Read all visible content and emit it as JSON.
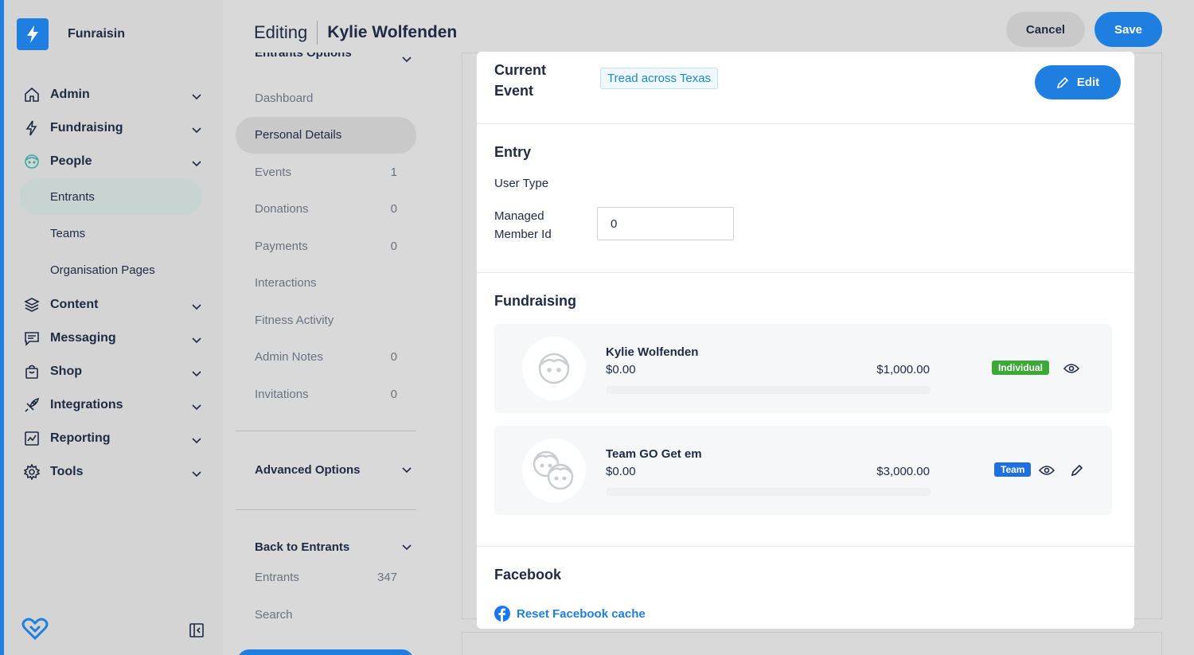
{
  "brand": {
    "name": "Funraisin"
  },
  "sidebar": {
    "items": [
      {
        "label": "Admin",
        "icon": "home-icon"
      },
      {
        "label": "Fundraising",
        "icon": "bolt-icon"
      },
      {
        "label": "People",
        "icon": "face-icon"
      },
      {
        "label": "Content",
        "icon": "layers-icon"
      },
      {
        "label": "Messaging",
        "icon": "message-icon"
      },
      {
        "label": "Shop",
        "icon": "bag-icon"
      },
      {
        "label": "Integrations",
        "icon": "rocket-icon"
      },
      {
        "label": "Reporting",
        "icon": "chart-icon"
      },
      {
        "label": "Tools",
        "icon": "gear-icon"
      }
    ],
    "people_sub": [
      "Entrants",
      "Teams",
      "Organisation Pages"
    ]
  },
  "header": {
    "editing_label": "Editing",
    "entity_name": "Kylie Wolfenden",
    "cancel_label": "Cancel",
    "save_label": "Save"
  },
  "subnav": {
    "entrants_options_label": "Entrants Options",
    "items": [
      {
        "label": "Dashboard",
        "count": ""
      },
      {
        "label": "Personal Details",
        "count": ""
      },
      {
        "label": "Events",
        "count": "1"
      },
      {
        "label": "Donations",
        "count": "0"
      },
      {
        "label": "Payments",
        "count": "0"
      },
      {
        "label": "Interactions",
        "count": ""
      },
      {
        "label": "Fitness Activity",
        "count": ""
      },
      {
        "label": "Admin Notes",
        "count": "0"
      },
      {
        "label": "Invitations",
        "count": "0"
      }
    ],
    "advanced_options_label": "Advanced Options",
    "back_label": "Back to Entrants",
    "back_items": [
      {
        "label": "Entrants",
        "count": "347"
      },
      {
        "label": "Search",
        "count": ""
      }
    ]
  },
  "current_event": {
    "label": "Current Event",
    "tag": "Tread across Texas",
    "edit_label": "Edit"
  },
  "entry": {
    "title": "Entry",
    "user_type_label": "User Type",
    "managed_member_label": "Managed Member Id",
    "managed_member_value": "0"
  },
  "fundraising": {
    "title": "Fundraising",
    "rows": [
      {
        "name": "Kylie Wolfenden",
        "raised": "$0.00",
        "target": "$1,000.00",
        "badge": "Individual",
        "badge_color": "#3aa935",
        "progress": 0
      },
      {
        "name": "Team GO Get em",
        "raised": "$0.00",
        "target": "$3,000.00",
        "badge": "Team",
        "badge_color": "#1e6fe0",
        "progress": 0
      }
    ]
  },
  "facebook": {
    "title": "Facebook",
    "reset_label": "Reset Facebook cache"
  },
  "colors": {
    "accent": "#1e7fe0"
  }
}
